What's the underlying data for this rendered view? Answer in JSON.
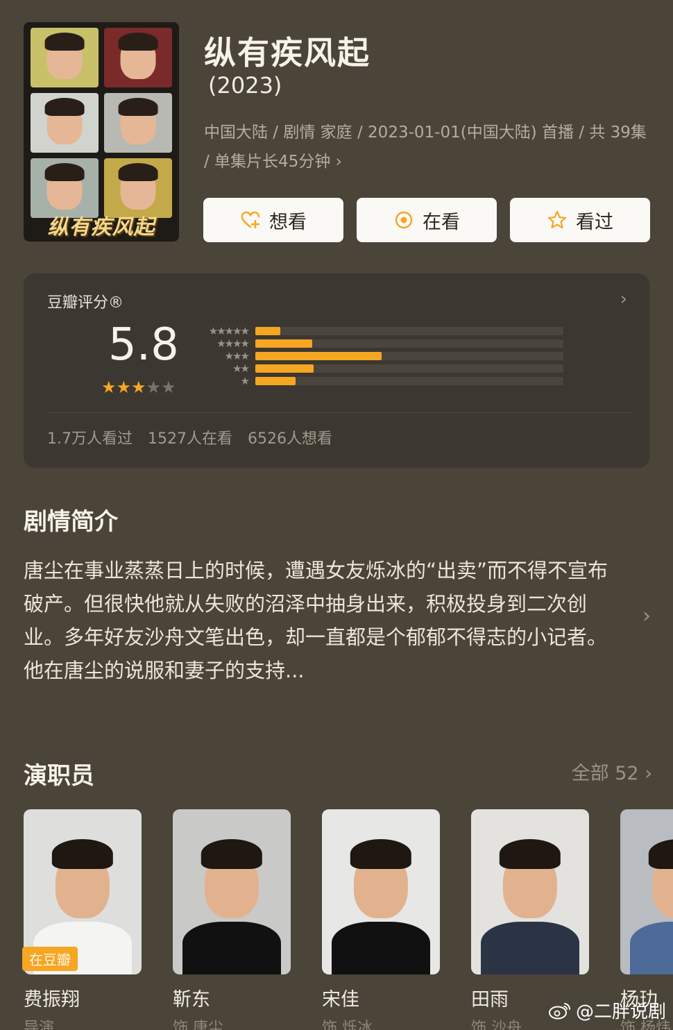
{
  "poster": {
    "title": "纵有疾风起"
  },
  "header": {
    "title": "纵有疾风起",
    "year": "(2023)",
    "meta": "中国大陆 / 剧情 家庭 / 2023-01-01(中国大陆) 首播 / 共 39集 / 单集片长45分钟",
    "meta_chevron": "›"
  },
  "actions": [
    {
      "label": "想看",
      "icon": "heart-plus-icon"
    },
    {
      "label": "在看",
      "icon": "target-icon"
    },
    {
      "label": "看过",
      "icon": "star-outline-icon"
    }
  ],
  "rating": {
    "label": "豆瓣评分®",
    "score": "5.8",
    "stars_on": 3,
    "stars_total": 5,
    "distribution": [
      {
        "stars": "★★★★★",
        "fraction": 0.08
      },
      {
        "stars": "★★★★",
        "fraction": 0.185
      },
      {
        "stars": "★★★",
        "fraction": 0.41
      },
      {
        "stars": "★★",
        "fraction": 0.19
      },
      {
        "stars": "★",
        "fraction": 0.13
      }
    ],
    "stats": [
      "1.7万人看过",
      "1527人在看",
      "6526人想看"
    ],
    "chevron": "›"
  },
  "synopsis": {
    "heading": "剧情简介",
    "text": "唐尘在事业蒸蒸日上的时候，遭遇女友烁冰的“出卖”而不得不宣布破产。但很快他就从失败的沼泽中抽身出来，积极投身到二次创业。多年好友沙舟文笔出色，却一直都是个郁郁不得志的小记者。他在唐尘的说服和妻子的支持...",
    "chevron": "›"
  },
  "cast": {
    "heading": "演职员",
    "all_label": "全部 52 ›",
    "badge": "在豆瓣",
    "members": [
      {
        "name": "费振翔",
        "role": "导演"
      },
      {
        "name": "靳东",
        "role": "饰 唐尘"
      },
      {
        "name": "宋佳",
        "role": "饰 烁冰"
      },
      {
        "name": "田雨",
        "role": "饰 沙舟"
      },
      {
        "name": "杨玏",
        "role": "饰 杨炜"
      }
    ]
  },
  "watermark": "@二胖说剧",
  "colors": {
    "accent": "#f5a623",
    "background": "#4a4439",
    "card": "#3c3730"
  }
}
